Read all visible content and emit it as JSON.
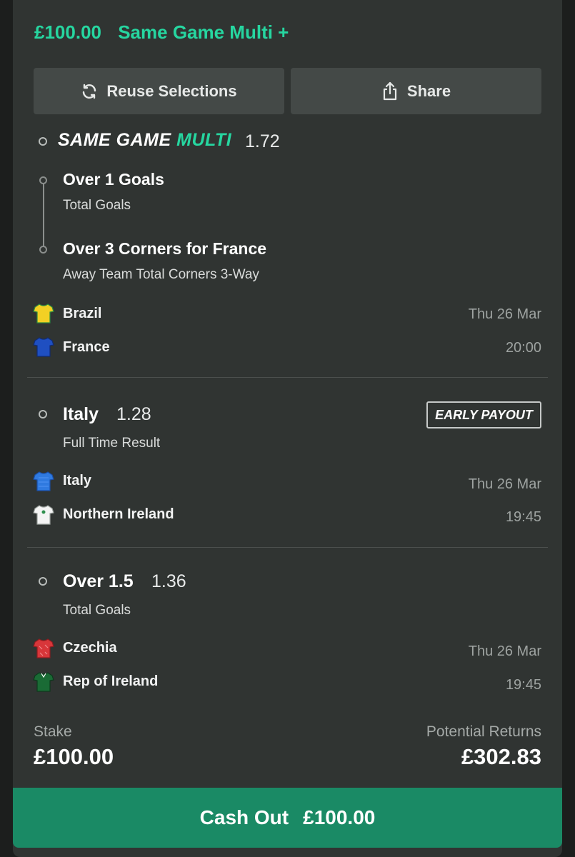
{
  "header": {
    "amount": "£100.00",
    "title": "Same Game Multi +"
  },
  "actions": {
    "reuse_label": "Reuse Selections",
    "share_label": "Share"
  },
  "sgm": {
    "logo_word1": "SAME GAME",
    "logo_word2": "MULTI",
    "odds": "1.72",
    "selections": [
      {
        "title": "Over 1 Goals",
        "market": "Total Goals"
      },
      {
        "title": "Over 3 Corners for France",
        "market": "Away Team Total Corners 3-Way"
      }
    ],
    "home_team": "Brazil",
    "away_team": "France",
    "date": "Thu 26 Mar",
    "time": "20:00"
  },
  "leg2": {
    "selection": "Italy",
    "odds": "1.28",
    "badge": "EARLY PAYOUT",
    "market": "Full Time Result",
    "home_team": "Italy",
    "away_team": "Northern Ireland",
    "date": "Thu 26 Mar",
    "time": "19:45"
  },
  "leg3": {
    "selection": "Over 1.5",
    "odds": "1.36",
    "market": "Total Goals",
    "home_team": "Czechia",
    "away_team": "Rep of Ireland",
    "date": "Thu 26 Mar",
    "time": "19:45"
  },
  "footer": {
    "stake_label": "Stake",
    "stake_value": "£100.00",
    "returns_label": "Potential Returns",
    "returns_value": "£302.83"
  },
  "cashout": {
    "label": "Cash Out",
    "amount": "£100.00"
  },
  "colors": {
    "accent_green": "#26d6a0",
    "cashout_green": "#1a8a65",
    "card_bg": "#303432",
    "kit_brazil": "#f2d024",
    "kit_france": "#1f4fc1",
    "kit_italy": "#2f7ae0",
    "kit_northern_ireland": "#f4f4f4",
    "kit_czechia": "#d8363a",
    "kit_rep_of_ireland": "#1a6b35"
  }
}
